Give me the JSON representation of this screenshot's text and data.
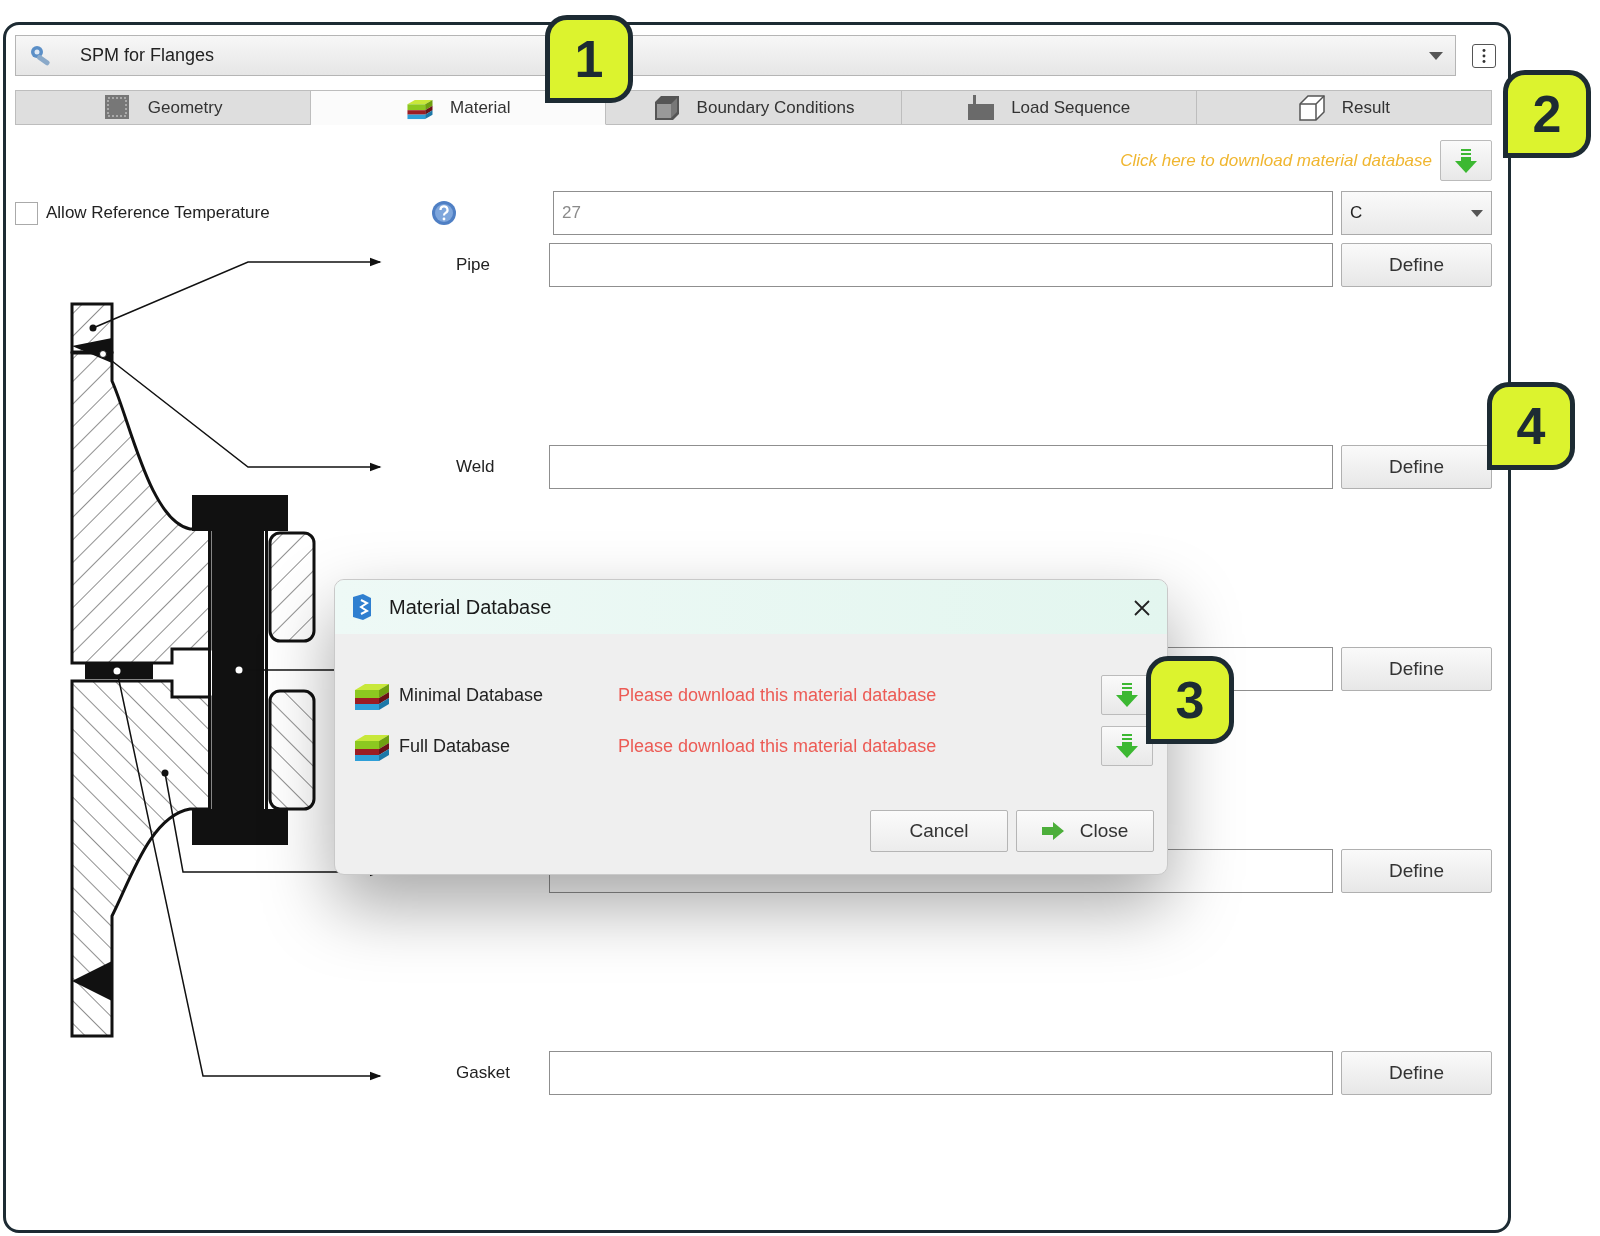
{
  "app": {
    "title": "SPM for Flanges"
  },
  "tabs": [
    {
      "label": "Geometry",
      "selected": false
    },
    {
      "label": "Material",
      "selected": true
    },
    {
      "label": "Boundary Conditions",
      "selected": false
    },
    {
      "label": "Load Sequence",
      "selected": false
    },
    {
      "label": "Result",
      "selected": false
    }
  ],
  "download_link": {
    "text": "Click here to download material database"
  },
  "reference_temperature": {
    "label": "Allow Reference Temperature",
    "checked": false,
    "value": "27",
    "disabled": true,
    "unit": "C"
  },
  "materials": [
    {
      "label": "Pipe",
      "button": "Define"
    },
    {
      "label": "Weld",
      "button": "Define"
    },
    {
      "button": "Define"
    },
    {
      "button": "Define"
    },
    {
      "label": "Gasket",
      "button": "Define"
    }
  ],
  "dialog": {
    "title": "Material Database",
    "databases": [
      {
        "name": "Minimal Database",
        "status": "Please download this material database"
      },
      {
        "name": "Full Database",
        "status": "Please download this material database"
      }
    ],
    "buttons": [
      {
        "label": "Cancel",
        "kind": "plain"
      },
      {
        "label": "Close",
        "kind": "arrow"
      }
    ]
  },
  "callouts": [
    "1",
    "2",
    "3",
    "4"
  ]
}
